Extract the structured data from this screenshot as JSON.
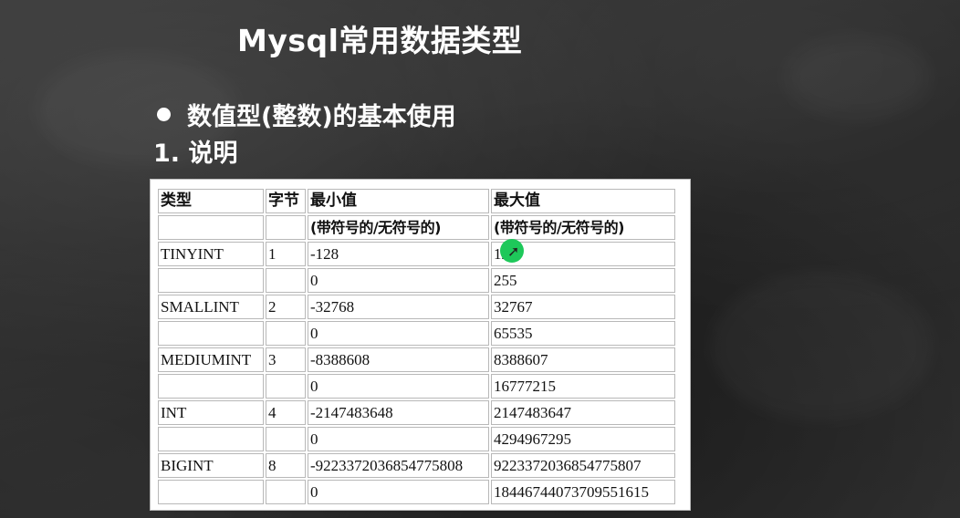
{
  "slide": {
    "title": "Mysql常用数据类型",
    "bullet": "数值型(整数)的基本使用",
    "subheading": "1. 说明"
  },
  "table": {
    "headers": [
      "类型",
      "字节",
      "最小值",
      "最大值"
    ],
    "subheaders": [
      "",
      "",
      "(带符号的/无符号的)",
      "(带符号的/无符号的)"
    ],
    "rows": [
      [
        "TINYINT",
        "1",
        "-128",
        "127"
      ],
      [
        "",
        "",
        "0",
        "255"
      ],
      [
        "SMALLINT",
        "2",
        "-32768",
        "32767"
      ],
      [
        "",
        "",
        "0",
        "65535"
      ],
      [
        "MEDIUMINT",
        "3",
        "-8388608",
        "8388607"
      ],
      [
        "",
        "",
        "0",
        "16777215"
      ],
      [
        "INT",
        "4",
        "-2147483648",
        "2147483647"
      ],
      [
        "",
        "",
        "0",
        "4294967295"
      ],
      [
        "BIGINT",
        "8",
        "-9223372036854775808",
        "9223372036854775807"
      ],
      [
        "",
        "",
        "0",
        "18446744073709551615"
      ]
    ]
  },
  "cursor": {
    "icon": "pointer-cursor-icon",
    "highlight_color": "#1ec85a"
  }
}
